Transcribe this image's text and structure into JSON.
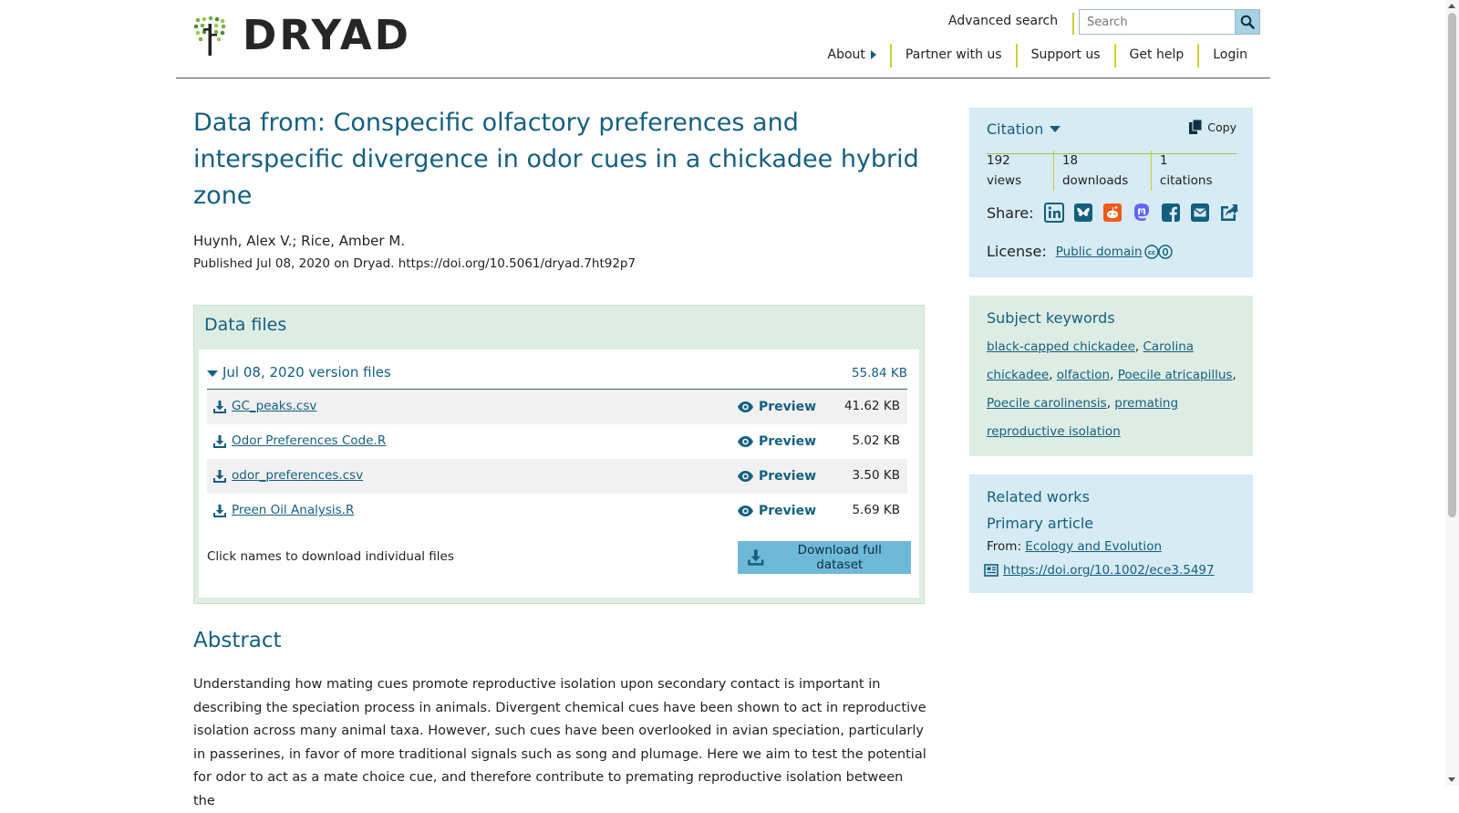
{
  "header": {
    "logo_text": "DRYAD",
    "advanced_search": "Advanced search",
    "search_placeholder": "Search",
    "nav": [
      "About",
      "Partner with us",
      "Support us",
      "Get help",
      "Login"
    ]
  },
  "dataset": {
    "title": "Data from: Conspecific olfactory preferences and interspecific divergence in odor cues in a chickadee hybrid zone",
    "authors": "Huynh, Alex V.; Rice, Amber M.",
    "published": "Published Jul 08, 2020 on Dryad. https://doi.org/10.5061/dryad.7ht92p7"
  },
  "data_files": {
    "heading": "Data files",
    "version_label": "Jul 08, 2020 version files",
    "version_size": "55.84 KB",
    "preview_label": "Preview",
    "files": [
      {
        "name": "GC_peaks.csv",
        "size": "41.62 KB"
      },
      {
        "name": "Odor Preferences Code.R",
        "size": "5.02 KB"
      },
      {
        "name": "odor_preferences.csv",
        "size": "3.50 KB"
      },
      {
        "name": "Preen Oil Analysis.R",
        "size": "5.69 KB"
      }
    ],
    "click_note": "Click names to download individual files",
    "download_full": "Download full dataset"
  },
  "abstract": {
    "heading": "Abstract",
    "text": "Understanding how mating cues promote reproductive isolation upon secondary contact is important in describing the speciation process in animals. Divergent chemical cues have been shown to act in reproductive isolation across many animal taxa. However, such cues have been overlooked in avian speciation, particularly in passerines, in favor of more traditional signals such as song and plumage. Here we aim to test the potential for odor to act as a mate choice cue, and therefore contribute to premating reproductive isolation between the"
  },
  "citation": {
    "label": "Citation",
    "copy": "Copy",
    "views": "192 views",
    "downloads": "18 downloads",
    "citations": "1 citations",
    "share_label": "Share:",
    "license_label": "License:",
    "license_value": "Public domain"
  },
  "keywords": {
    "heading": "Subject keywords",
    "items": [
      "black-capped chickadee",
      "Carolina chickadee",
      "olfaction",
      "Poecile atricapillus",
      "Poecile carolinensis",
      "premating reproductive isolation"
    ]
  },
  "related": {
    "heading": "Related works",
    "subheading": "Primary article",
    "from_label": "From:",
    "journal": "Ecology and Evolution",
    "doi": "https://doi.org/10.1002/ece3.5497"
  },
  "icons": {
    "share": [
      "linkedin-icon",
      "bluesky-icon",
      "reddit-icon",
      "mastodon-icon",
      "facebook-icon",
      "email-icon",
      "share-icon"
    ],
    "colors": {
      "accent": "#145f80",
      "lime": "#c7d232",
      "citation_bg": "#d6ebf3",
      "keywords_bg": "#deede4",
      "download_btn": "#6fb9d8"
    }
  }
}
